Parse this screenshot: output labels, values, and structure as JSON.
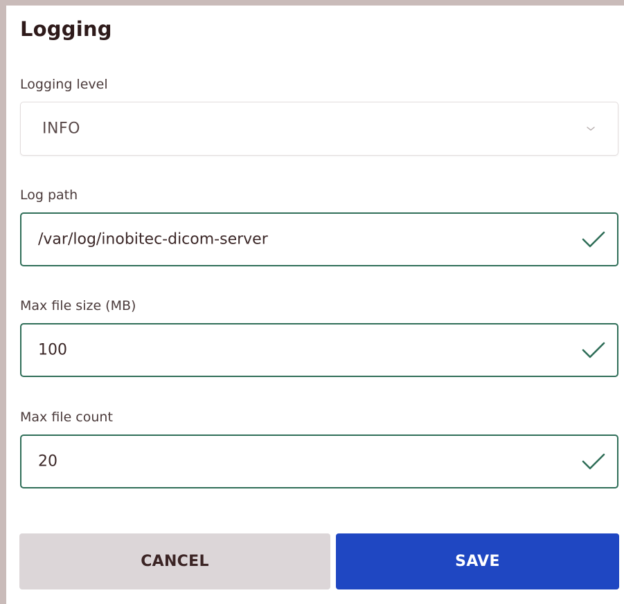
{
  "section": {
    "title": "Logging"
  },
  "logging_level": {
    "label": "Logging level",
    "selected": "INFO",
    "icon": "chevron-down-icon"
  },
  "log_path": {
    "label": "Log path",
    "value": "/var/log/inobitec-dicom-server",
    "valid": true
  },
  "max_file_size": {
    "label": "Max file size (MB)",
    "value": "100",
    "valid": true
  },
  "max_file_count": {
    "label": "Max file count",
    "value": "20",
    "valid": true
  },
  "actions": {
    "cancel_label": "CANCEL",
    "save_label": "SAVE"
  },
  "colors": {
    "valid_border": "#2f6e58",
    "primary": "#1f47c2",
    "secondary": "#dcd6d8",
    "frame": "#c9bbb9"
  }
}
